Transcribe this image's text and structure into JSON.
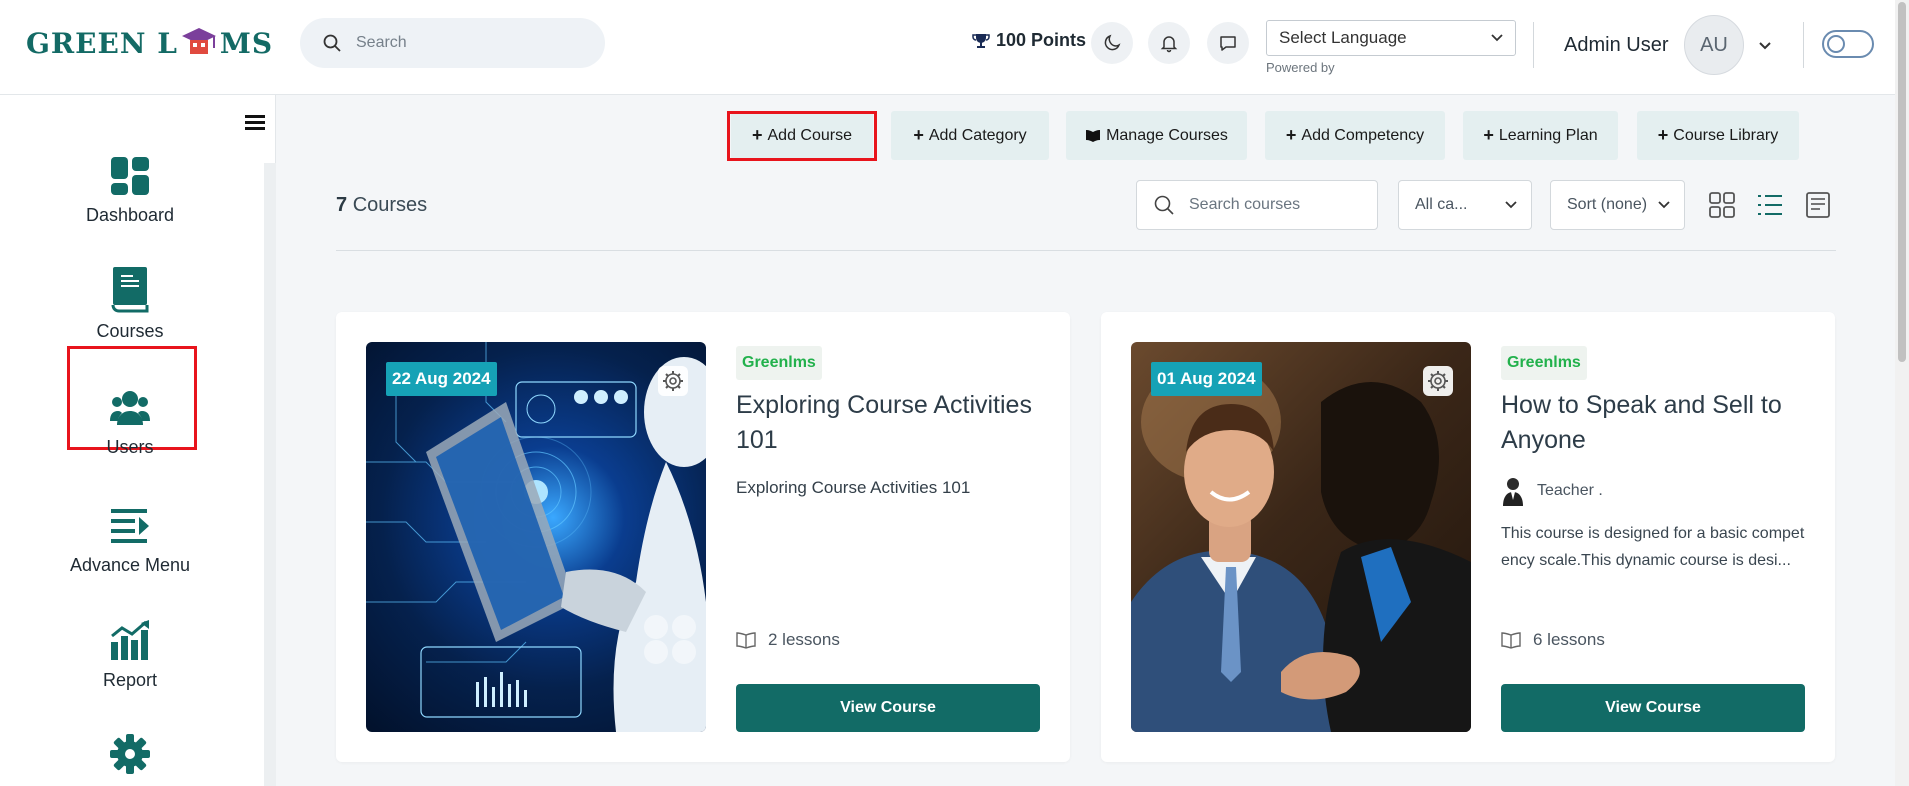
{
  "header": {
    "logo_text_left": "GREEN L",
    "logo_text_right": "MS",
    "search_placeholder": "Search",
    "points": "100 Points",
    "language_select": "Select Language",
    "powered_by": "Powered by",
    "user_name": "Admin User",
    "avatar_initials": "AU"
  },
  "sidebar": {
    "items": [
      {
        "label": "Dashboard",
        "icon": "dashboard-icon"
      },
      {
        "label": "Courses",
        "icon": "book-icon"
      },
      {
        "label": "Users",
        "icon": "users-icon"
      },
      {
        "label": "Advance Menu",
        "icon": "menu-icon"
      },
      {
        "label": "Report",
        "icon": "chart-icon"
      },
      {
        "label": "",
        "icon": "gear-icon"
      }
    ]
  },
  "toolbar": {
    "add_course": "Add Course",
    "add_category": "Add Category",
    "manage_courses": "Manage Courses",
    "add_competency": "Add Competency",
    "learning_plan": "Learning Plan",
    "course_library": "Course Library"
  },
  "filters": {
    "count_number": "7",
    "count_label": "Courses",
    "search_placeholder": "Search courses",
    "category_select": "All ca...",
    "sort_select": "Sort (none)"
  },
  "courses": [
    {
      "date": "22 Aug 2024",
      "tag": "Greenlms",
      "title": "Exploring Course Activities 101",
      "subtitle": "Exploring Course Activities 101",
      "lessons": "2 lessons",
      "button": "View Course"
    },
    {
      "date": "01 Aug 2024",
      "tag": "Greenlms",
      "title": "How to Speak and Sell to Anyone",
      "teacher": "Teacher .",
      "description": "This course is designed for a basic competency scale.This dynamic course is desi...",
      "lessons": "6 lessons",
      "button": "View Course"
    }
  ],
  "colors": {
    "brand": "#126b66",
    "badge": "#16a2b6",
    "tag": "#22b14c",
    "highlight": "#e8141c"
  }
}
